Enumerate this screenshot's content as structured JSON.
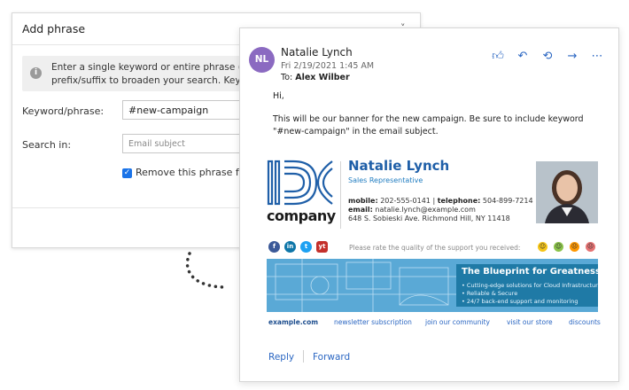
{
  "dialog": {
    "title": "Add phrase",
    "caret": "˅",
    "info_line1": "Enter a single keyword or entire phrase (multip",
    "info_line2": "prefix/suffix to broaden your search. Keywords/",
    "keyword_label": "Keyword/phrase:",
    "keyword_value": "#new-campaign",
    "search_in_label": "Search in:",
    "search_in_value": "Email subject",
    "checkbox_label": "Remove this phrase from"
  },
  "email": {
    "avatar_initials": "NL",
    "sender": "Natalie Lynch",
    "date": "Fri 2/19/2021 1:45 AM",
    "to_label": "To:",
    "to_value": "Alex Wilber",
    "actions": [
      "like-icon",
      "reply-icon",
      "reply-all-icon",
      "forward-icon",
      "more-icon"
    ],
    "greeting": "Hi,",
    "body_line1": "This will be our banner for the new campaign. Be sure to include keyword",
    "body_line2": "\"#new-campaign\" in the email subject.",
    "reply": "Reply",
    "forward": "Forward"
  },
  "signature": {
    "logo_word": "company",
    "name": "Natalie Lynch",
    "title": "Sales Representative",
    "mobile_label": "mobile:",
    "mobile": "202-555-0141",
    "separator": "|",
    "telephone_label": "telephone:",
    "telephone": "504-899-7214",
    "email_label": "email:",
    "email": "natalie.lynch@example.com",
    "address": "648 S. Sobieski Ave. Richmond Hill, NY 11418",
    "social": [
      "f",
      "in",
      "t",
      "yt"
    ],
    "rate_text": "Please rate the quality of the support you received:",
    "banner_title": "The Blueprint for Greatness:",
    "banner_bullets": [
      "• Cutting-edge solutions for Cloud Infrastructure",
      "• Reliable & Secure",
      "• 24/7 back-end support and monitoring"
    ],
    "links": [
      "example.com",
      "newsletter subscription",
      "join our community",
      "visit our store",
      "discounts"
    ]
  },
  "colors": {
    "accent": "#2a66c2",
    "avatar": "#8b6ac1",
    "logo_blue": "#1f5fa8",
    "banner_blue": "#5aa9d6",
    "banner_panel": "#1f7aa6"
  }
}
